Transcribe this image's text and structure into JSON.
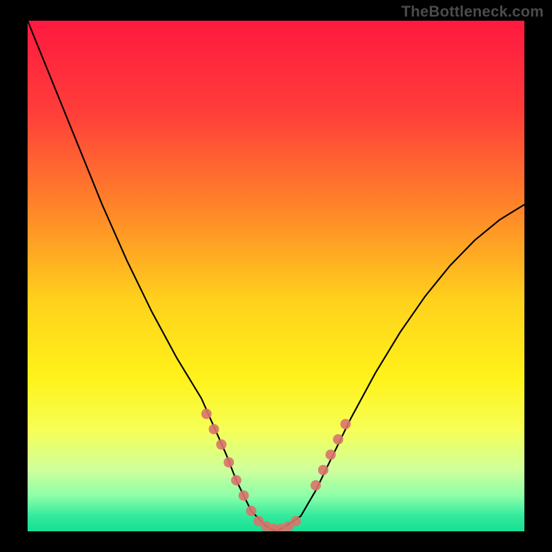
{
  "watermark": "TheBottleneck.com",
  "chart_data": {
    "type": "line",
    "title": "",
    "xlabel": "",
    "ylabel": "",
    "xlim": [
      0,
      100
    ],
    "ylim": [
      0,
      100
    ],
    "series": [
      {
        "name": "bottleneck-curve",
        "x": [
          0,
          5,
          10,
          15,
          20,
          25,
          30,
          35,
          40,
          42,
          45,
          48,
          50,
          52,
          55,
          58,
          60,
          65,
          70,
          75,
          80,
          85,
          90,
          95,
          100
        ],
        "y": [
          100,
          88,
          76,
          64,
          53,
          43,
          34,
          26,
          15,
          10,
          4,
          1,
          0,
          1,
          3,
          8,
          12,
          22,
          31,
          39,
          46,
          52,
          57,
          61,
          64
        ]
      }
    ],
    "markers": {
      "name": "highlight-points",
      "color": "#d9736b",
      "x": [
        36,
        37.5,
        39,
        40.5,
        42,
        43.5,
        45,
        46.5,
        48,
        49.5,
        51,
        52.5,
        54,
        58,
        59.5,
        61,
        62.5,
        64
      ],
      "y": [
        23,
        20,
        17,
        13.5,
        10,
        7,
        4,
        2,
        1,
        0.5,
        0.5,
        1,
        2,
        9,
        12,
        15,
        18,
        21
      ]
    },
    "gradient_stops": [
      {
        "offset": 0.0,
        "color": "#ff193f"
      },
      {
        "offset": 0.18,
        "color": "#ff3e3a"
      },
      {
        "offset": 0.38,
        "color": "#ff8a28"
      },
      {
        "offset": 0.55,
        "color": "#ffd21c"
      },
      {
        "offset": 0.7,
        "color": "#fff21a"
      },
      {
        "offset": 0.8,
        "color": "#f6ff55"
      },
      {
        "offset": 0.88,
        "color": "#cfff9c"
      },
      {
        "offset": 0.93,
        "color": "#8effa8"
      },
      {
        "offset": 0.97,
        "color": "#33ea9d"
      },
      {
        "offset": 1.0,
        "color": "#18df95"
      }
    ]
  }
}
